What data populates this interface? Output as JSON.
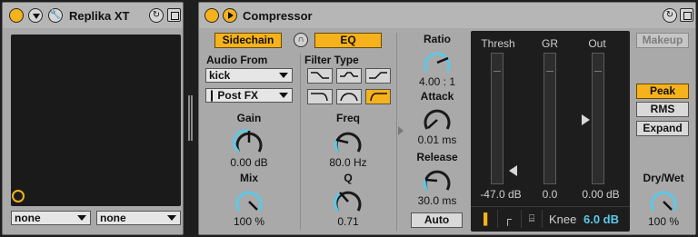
{
  "replika": {
    "title": "Replika XT",
    "selects": [
      "none",
      "none"
    ]
  },
  "compressor": {
    "title": "Compressor",
    "sidechain_label": "Sidechain",
    "eq_label": "EQ",
    "audio_from_label": "Audio From",
    "audio_from_value": "kick",
    "post_fx_value": "Post FX",
    "gain_label": "Gain",
    "gain_value": "0.00 dB",
    "mix_label": "Mix",
    "mix_value": "100 %",
    "filter_type_label": "Filter Type",
    "freq_label": "Freq",
    "freq_value": "80.0 Hz",
    "q_label": "Q",
    "q_value": "0.71",
    "ratio_label": "Ratio",
    "ratio_value": "4.00 : 1",
    "attack_label": "Attack",
    "attack_value": "0.01 ms",
    "release_label": "Release",
    "release_value": "30.0 ms",
    "auto_label": "Auto",
    "thresh_label": "Thresh",
    "gr_label": "GR",
    "out_label": "Out",
    "thresh_value": "-47.0 dB",
    "gr_value": "0.0",
    "out_value": "0.00 dB",
    "knee_label": "Knee",
    "knee_value": "6.0 dB",
    "makeup_label": "Makeup",
    "peak_label": "Peak",
    "rms_label": "RMS",
    "expand_label": "Expand",
    "drywet_label": "Dry/Wet",
    "drywet_value": "100 %"
  },
  "colors": {
    "accent": "#f6b21b",
    "knob_arc": "#5cc8e8",
    "knee_value": "#5cc8e8"
  }
}
